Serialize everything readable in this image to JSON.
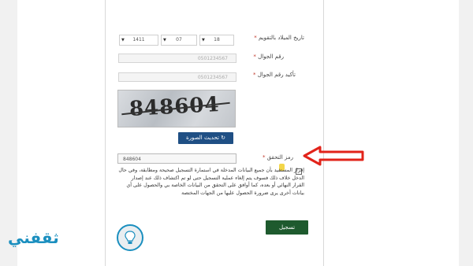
{
  "form": {
    "birthdate_label": "تاريخ الميلاد بالتقويم",
    "birthdate_required": "*",
    "birthdate_year": "1411",
    "birthdate_month": "07",
    "birthdate_day": "18",
    "mobile_label": "رقم الجوال",
    "mobile_required": "*",
    "mobile_value": "0501234567",
    "confirm_mobile_label": "تأكيد رقم الجوال",
    "confirm_mobile_required": "*",
    "confirm_mobile_value": "0501234567",
    "captcha_image_text": "848604",
    "refresh_button": "تحديث الصورة",
    "captcha_label": "رمز التحقق",
    "captcha_required": "*",
    "captcha_value": "848604",
    "terms_text": "إقرار المستفيد بأن جميع البيانات المدخلة في استمارة التسجيل صحيحة ومطابقة، وفي حال الدخل خلاف ذلك فسوف يتم إلغاء عملية التسجيل حتى لو تم اكتشاف ذلك عند إصدار القرار النهائي أو بعده، كما أوافق على التحقق من البيانات الخاصة بي والحصول على أي بيانات أخرى يرى ضرورة الحصول عليها من الجهات المختصة",
    "submit_button": "تسجيل"
  },
  "brand": {
    "logo_text": "ثقفني",
    "logo_color": "#1b8fbf"
  },
  "colors": {
    "primary_button": "#1f4f84",
    "submit_button": "#1e5a2e",
    "annotation_arrow": "#e2231a"
  }
}
